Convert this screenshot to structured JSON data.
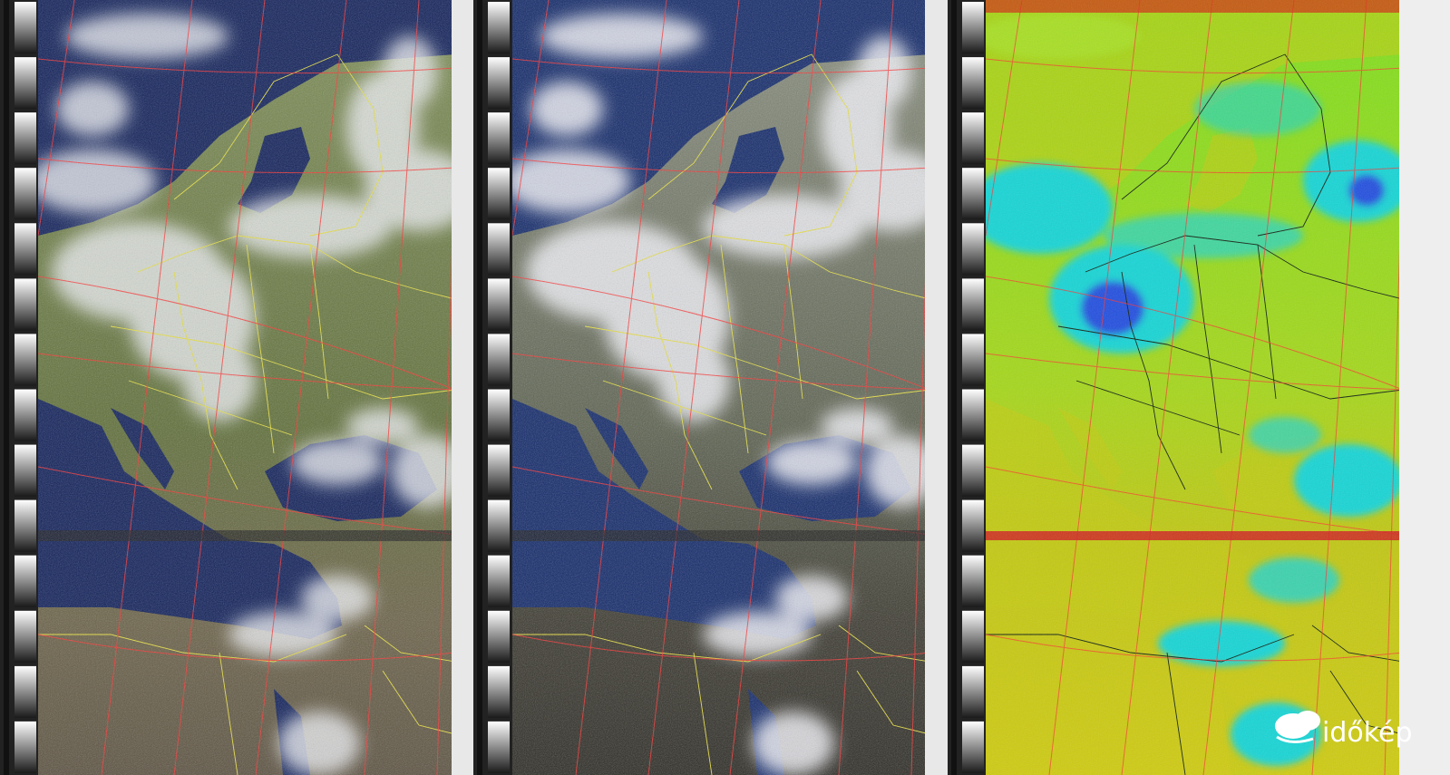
{
  "panels": [
    {
      "id": "left",
      "kind": "false-color-visible"
    },
    {
      "id": "middle",
      "kind": "natural-color-visible"
    },
    {
      "id": "right",
      "kind": "thermal-infrared-palette"
    }
  ],
  "telemetry": {
    "wedge_count": 14
  },
  "watermark": {
    "text": "időkép"
  },
  "colors": {
    "sea_left": "#10205a",
    "sea_mid": "#12296a",
    "land_left": "#6d7d45",
    "land_mid": "#6f7469",
    "cloud": "#eef0f4",
    "ir_warm": "#c6cc10",
    "ir_mid": "#7fe01c",
    "ir_cold": "#18d6d6",
    "ir_coldest": "#2050e0",
    "graticule": "#ff3030",
    "borders_visible": "#e8e040",
    "coast_visible": "#80f080",
    "borders_ir": "#102010"
  }
}
